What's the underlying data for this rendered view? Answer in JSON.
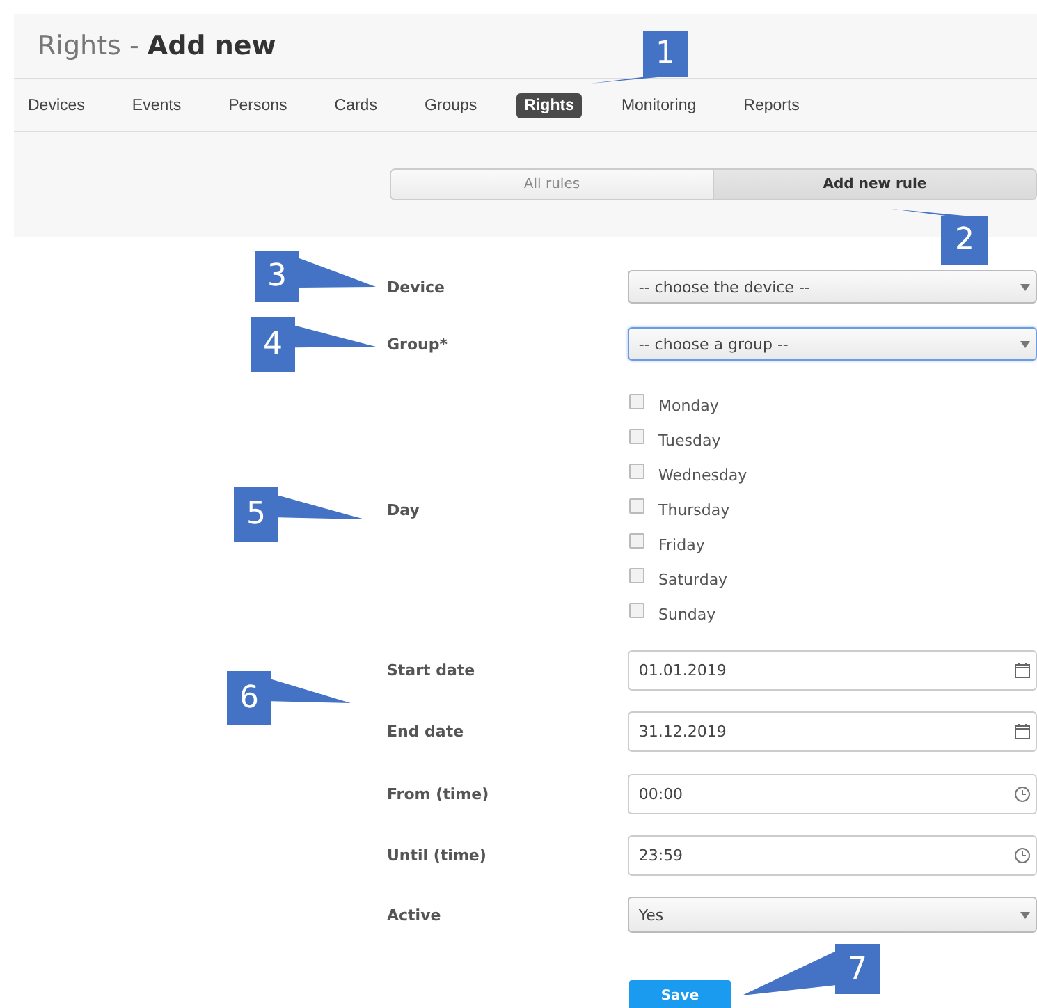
{
  "page": {
    "title_prefix": "Rights - ",
    "title_main": "Add new"
  },
  "nav": [
    {
      "label": "Devices",
      "selected": false
    },
    {
      "label": "Events",
      "selected": false
    },
    {
      "label": "Persons",
      "selected": false
    },
    {
      "label": "Cards",
      "selected": false
    },
    {
      "label": "Groups",
      "selected": false
    },
    {
      "label": "Rights",
      "selected": true
    },
    {
      "label": "Monitoring",
      "selected": false
    },
    {
      "label": "Reports",
      "selected": false
    }
  ],
  "segments": [
    {
      "label": "All rules",
      "selected": false
    },
    {
      "label": "Add new rule",
      "selected": true
    }
  ],
  "form": {
    "rows": [
      {
        "kind": "select",
        "label": "Device",
        "value": "-- choose the device --",
        "focused": false
      },
      {
        "kind": "select",
        "label": "Group*",
        "value": "-- choose a group --",
        "focused": true
      },
      {
        "kind": "days",
        "label": "Day",
        "options": [
          {
            "label": "Monday",
            "checked": false
          },
          {
            "label": "Tuesday",
            "checked": false
          },
          {
            "label": "Wednesday",
            "checked": false
          },
          {
            "label": "Thursday",
            "checked": false
          },
          {
            "label": "Friday",
            "checked": false
          },
          {
            "label": "Saturday",
            "checked": false
          },
          {
            "label": "Sunday",
            "checked": false
          }
        ]
      },
      {
        "kind": "date",
        "label": "Start date",
        "value": "01.01.2019"
      },
      {
        "kind": "date",
        "label": "End date",
        "value": "31.12.2019"
      },
      {
        "kind": "time",
        "label": "From (time)",
        "value": "00:00"
      },
      {
        "kind": "time",
        "label": "Until (time)",
        "value": "23:59"
      },
      {
        "kind": "select",
        "label": "Active",
        "value": "Yes",
        "focused": false
      }
    ],
    "save_button": "Save"
  },
  "callouts": [
    {
      "number": "1"
    },
    {
      "number": "2"
    },
    {
      "number": "3"
    },
    {
      "number": "4"
    },
    {
      "number": "5"
    },
    {
      "number": "6"
    },
    {
      "number": "7"
    }
  ]
}
